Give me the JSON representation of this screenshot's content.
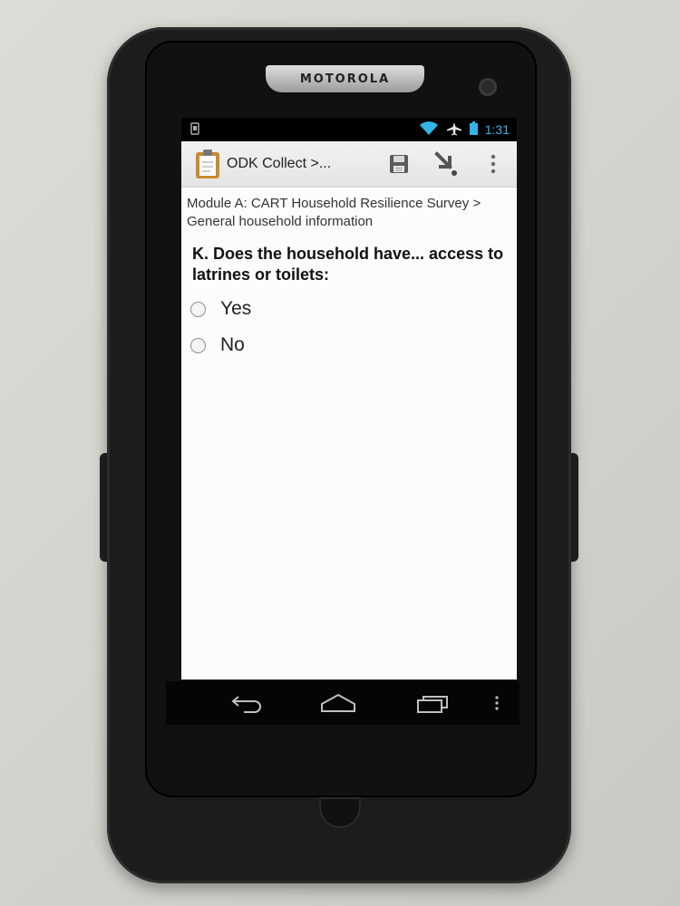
{
  "device": {
    "brand": "MOTOROLA"
  },
  "status_bar": {
    "time": "1:31",
    "icons": [
      "usb-debug-icon",
      "wifi-icon",
      "airplane-mode-icon",
      "battery-icon"
    ]
  },
  "action_bar": {
    "title": "ODK Collect >...",
    "icons": [
      "clipboard-app-icon",
      "save-icon",
      "go-to-prompt-icon",
      "overflow-menu-icon"
    ]
  },
  "form": {
    "breadcrumb": "Module A: CART Household Resilience Survey > General household information",
    "question": "K. Does the household have... access to latrines or toilets:",
    "options": [
      {
        "label": "Yes",
        "selected": false
      },
      {
        "label": "No",
        "selected": false
      }
    ]
  },
  "nav_bar": {
    "icons": [
      "back-icon",
      "home-icon",
      "recent-apps-icon",
      "menu-icon"
    ]
  },
  "colors": {
    "accent": "#33b5e5",
    "screen_bg": "#fbfcfb",
    "action_bar": "#e9e9e9"
  }
}
